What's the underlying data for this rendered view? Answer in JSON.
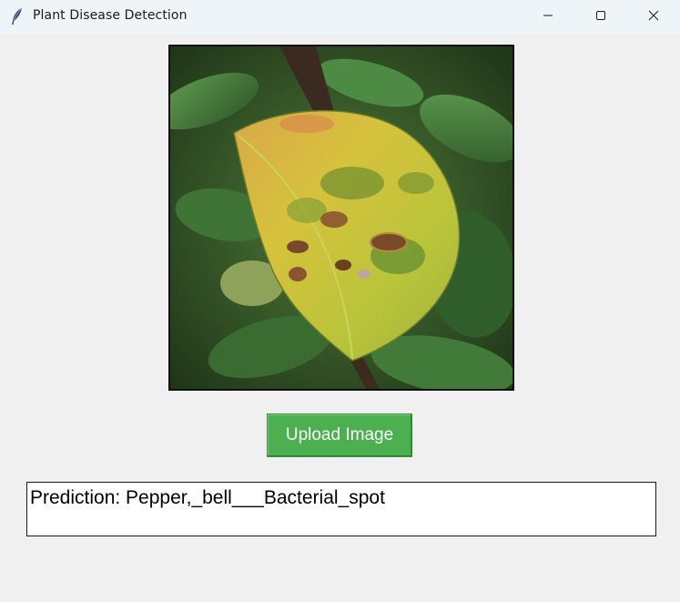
{
  "window": {
    "title": "Plant Disease Detection",
    "icon": "feather-icon",
    "controls": [
      "minimize-icon",
      "maximize-icon",
      "close-icon"
    ]
  },
  "main": {
    "image": {
      "subject": "leaf-image",
      "description": "Yellow-green leaf with brown spots"
    },
    "upload_button_label": "Upload Image",
    "prediction_text": "Prediction: Pepper,_bell___Bacterial_spot"
  },
  "colors": {
    "button": "#4caf50",
    "background": "#f0f0f0",
    "titlebar": "#eff4f9"
  }
}
